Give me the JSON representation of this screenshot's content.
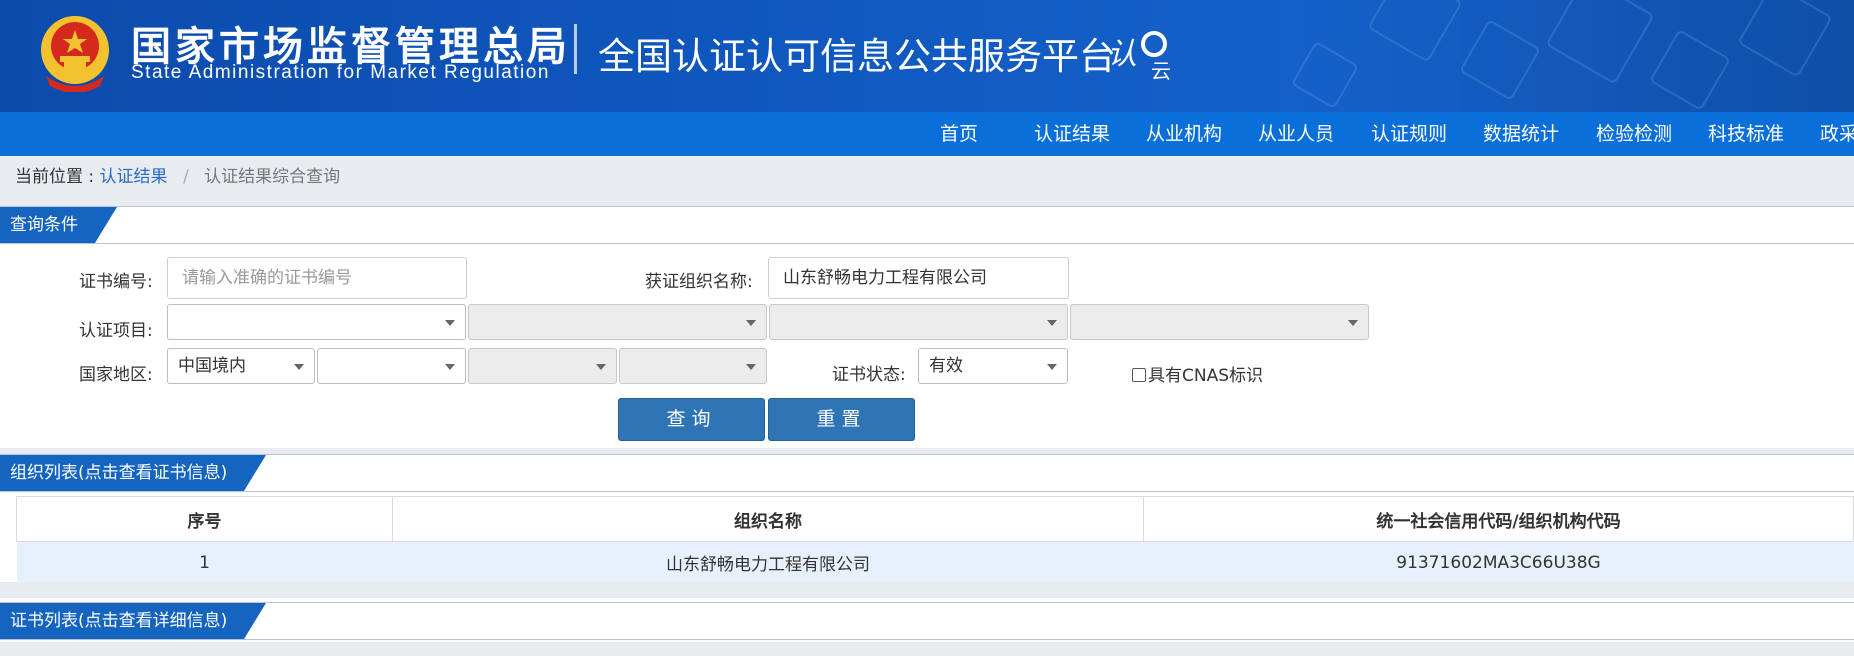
{
  "header": {
    "agency_cn": "国家市场监督管理总局",
    "agency_en": "State Administration  for  Market Regulation",
    "platform_title": "全国认证认可信息公共服务平台",
    "platform_logo_text": "认e云"
  },
  "nav": {
    "items": [
      "首页",
      "认证结果",
      "从业机构",
      "从业人员",
      "认证规则",
      "数据统计",
      "检验检测",
      "科技标准",
      "政采"
    ]
  },
  "breadcrumb": {
    "prefix": "当前位置 :",
    "link": "认证结果",
    "separator": "/",
    "current": "认证结果综合查询"
  },
  "query_section": {
    "title": "查询条件",
    "cert_no_label": "证书编号:",
    "cert_no_placeholder": "请输入准确的证书编号",
    "org_name_label": "获证组织名称:",
    "org_name_value": "山东舒畅电力工程有限公司",
    "cert_item_label": "认证项目:",
    "region_label": "国家地区:",
    "region_value": "中国境内",
    "status_label": "证书状态:",
    "status_value": "有效",
    "cnas_label": "具有CNAS标识",
    "search_button": "查询",
    "reset_button": "重置"
  },
  "org_list": {
    "title": "组织列表(点击查看证书信息)",
    "columns": [
      "序号",
      "组织名称",
      "统一社会信用代码/组织机构代码"
    ],
    "rows": [
      [
        "1",
        "山东舒畅电力工程有限公司",
        "91371602MA3C66U38G"
      ]
    ]
  },
  "cert_list": {
    "title": "证书列表(点击查看详细信息)"
  },
  "colors": {
    "banner": "#0f57bf",
    "nav": "#0a6fd8",
    "section_tab": "#1565c0",
    "button": "#2f74b5",
    "row_highlight": "#e8f1fb"
  }
}
